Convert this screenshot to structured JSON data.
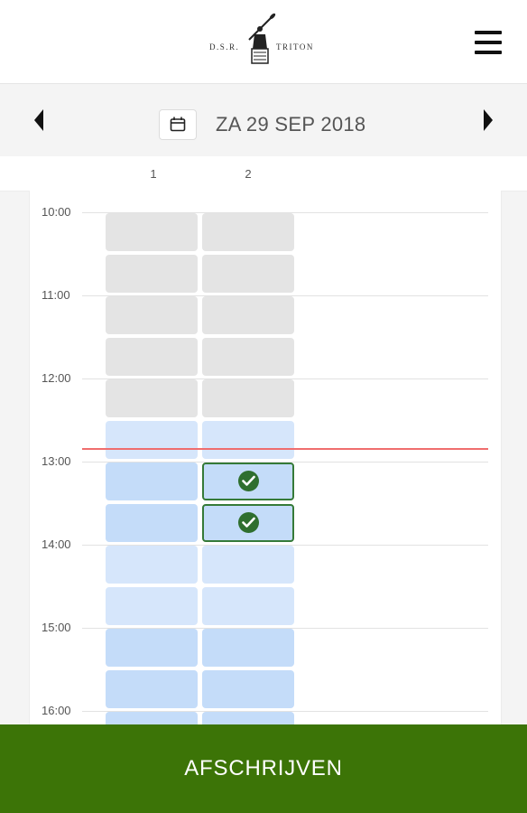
{
  "header": {
    "logo_left_text": "D.S.R.",
    "logo_right_text": "TRITON",
    "menu_icon": "hamburger-icon"
  },
  "datebar": {
    "prev_icon": "caret-left-icon",
    "calendar_icon": "calendar-icon",
    "date": "ZA 29 SEP 2018",
    "next_icon": "caret-right-icon"
  },
  "columns": [
    "1",
    "2"
  ],
  "hours": [
    "10:00",
    "11:00",
    "12:00",
    "13:00",
    "14:00",
    "15:00",
    "16:00"
  ],
  "slots": {
    "status_sequence": [
      "unavailable",
      "unavailable",
      "unavailable",
      "unavailable",
      "unavailable",
      "free",
      "free-highlight",
      "free-highlight",
      "free",
      "free",
      "free-highlight",
      "free-highlight",
      "free-highlight"
    ],
    "booked": [
      {
        "column": "2",
        "slot_index": 6
      },
      {
        "column": "2",
        "slot_index": 7
      }
    ],
    "colors": {
      "unavailable": "#e4e4e4",
      "free": "#d6e6fb",
      "free-highlight": "#c4dcf9",
      "booked_border": "#357a38"
    }
  },
  "booked_icon": "check-circle-icon",
  "current_time_line_color": "#ef6e6e",
  "action": {
    "label": "AFSCHRIJVEN",
    "color": "#3c7407"
  }
}
